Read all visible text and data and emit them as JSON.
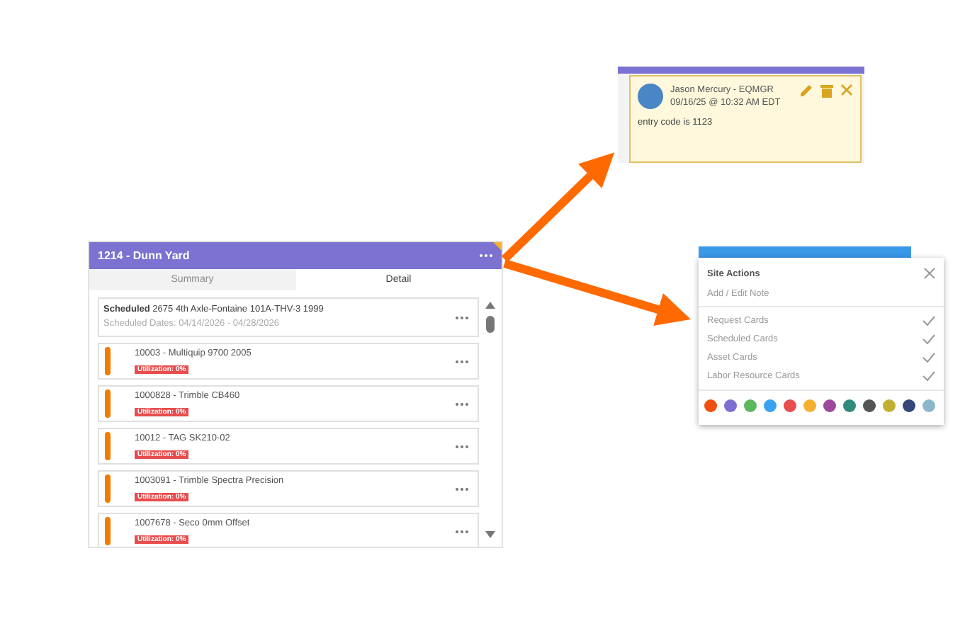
{
  "site_card": {
    "title": "1214 - Dunn Yard",
    "tabs": [
      {
        "label": "Summary",
        "selected": false
      },
      {
        "label": "Detail",
        "selected": true
      }
    ],
    "scheduled": {
      "label": "Scheduled",
      "text": "2675 4th Axle-Fontaine 101A-THV-3 1999",
      "dates": "Scheduled Dates: 04/14/2026 - 04/28/2026"
    },
    "assets": [
      {
        "name": "10003 - Multiquip 9700 2005",
        "badge": "Utilization: 0%",
        "color": "#f07c00"
      },
      {
        "name": "1000828 - Trimble CB460",
        "badge": "Utilization: 0%",
        "color": "#f07c00"
      },
      {
        "name": "10012 - TAG SK210-02",
        "badge": "Utilization: 0%",
        "color": "#f07c00"
      },
      {
        "name": "1003091 - Trimble Spectra Precision",
        "badge": "Utilization: 0%",
        "color": "#f07c00"
      },
      {
        "name": "1007678 - Seco 0mm Offset",
        "badge": "Utilization: 0%",
        "color": "#f07c00"
      }
    ]
  },
  "note": {
    "author": "Jason Mercury - EQMGR",
    "time": "09/16/25 @ 10:32 AM EDT",
    "text": "entry code is 1123"
  },
  "site_actions": {
    "title": "Site Actions",
    "note_action": "Add / Edit Note",
    "toggles": [
      {
        "label": "Request Cards",
        "checked": true
      },
      {
        "label": "Scheduled Cards",
        "checked": true
      },
      {
        "label": "Asset Cards",
        "checked": true
      },
      {
        "label": "Labor Resource Cards",
        "checked": true
      }
    ],
    "colors": [
      {
        "color": "#f04e0f"
      },
      {
        "color": "#7c6fd0"
      },
      {
        "color": "#5cb85c"
      },
      {
        "color": "#3aa0f0"
      },
      {
        "color": "#e84c4c"
      },
      {
        "color": "#f5b030"
      },
      {
        "color": "#9b4a9b"
      },
      {
        "color": "#2e8b7a"
      },
      {
        "color": "#555555"
      },
      {
        "color": "#c0b030"
      },
      {
        "color": "#34467a"
      },
      {
        "color": "#8ab8c8"
      }
    ]
  }
}
